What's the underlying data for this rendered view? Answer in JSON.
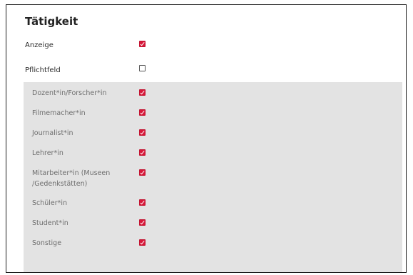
{
  "section": {
    "title": "Tätigkeit"
  },
  "fields": {
    "anzeige": {
      "label": "Anzeige",
      "checked": true
    },
    "pflichtfeld": {
      "label": "Pflichtfeld",
      "checked": false
    }
  },
  "options": [
    {
      "label": "Dozent*in/Forscher*in",
      "checked": true
    },
    {
      "label": "Filmemacher*in",
      "checked": true
    },
    {
      "label": "Journalist*in",
      "checked": true
    },
    {
      "label": "Lehrer*in",
      "checked": true
    },
    {
      "label_line1": "Mitarbeiter*in (Museen",
      "label_line2": "/Gedenkstätten)",
      "checked": true
    },
    {
      "label": "Schüler*in",
      "checked": true
    },
    {
      "label": "Student*in",
      "checked": true
    },
    {
      "label": "Sonstige",
      "checked": true
    }
  ],
  "colors": {
    "accent": "#d6183a",
    "panel_bg": "#e3e3e3"
  }
}
